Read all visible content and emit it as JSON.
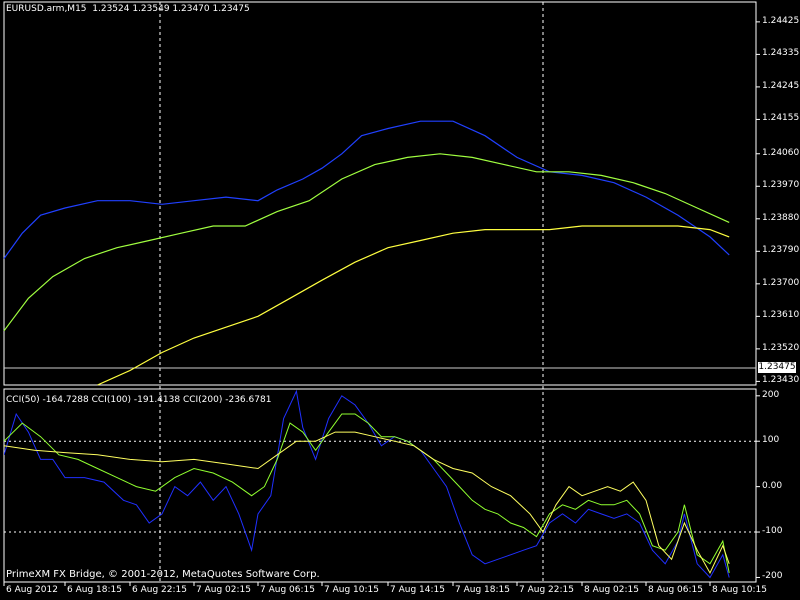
{
  "header": {
    "symbol": "EURUSD.arm,M15",
    "ohlc": "1.23524 1.23549 1.23470 1.23475"
  },
  "cci_header": {
    "text": "CCI(50) -164.7288  CCI(100) -191.4138  CCI(200) -236.6781"
  },
  "footer": {
    "text": "PrimeXM FX Bridge, © 2001-2012, MetaQuotes Software Corp."
  },
  "current_price": "1.23475",
  "colors": {
    "background": "#000000",
    "axis": "#ffffff",
    "upper": "#2040ff",
    "middle": "#a0ff40",
    "lower": "#ffff40",
    "cci_blue": "#2030ff",
    "cci_green": "#90ff30",
    "cci_yellow": "#ffff60"
  },
  "chart_data": [
    {
      "type": "line",
      "name": "price",
      "y_ticks": [
        "1.24425",
        "1.24335",
        "1.24245",
        "1.24155",
        "1.24060",
        "1.23970",
        "1.23880",
        "1.23790",
        "1.23700",
        "1.23610",
        "1.23520",
        "1.23430"
      ],
      "y_tick_values": [
        1.24425,
        1.24335,
        1.24245,
        1.24155,
        1.2406,
        1.2397,
        1.2388,
        1.2379,
        1.237,
        1.2361,
        1.2352,
        1.2343
      ],
      "ylim": [
        1.2342,
        1.2448
      ],
      "x_ticks": [
        "6 Aug 2012",
        "6 Aug 18:15",
        "6 Aug 22:15",
        "7 Aug 02:15",
        "7 Aug 06:15",
        "7 Aug 10:15",
        "7 Aug 14:15",
        "7 Aug 18:15",
        "7 Aug 22:15",
        "8 Aug 02:15",
        "8 Aug 06:15",
        "8 Aug 10:15"
      ],
      "x_tick_index": [
        0,
        1,
        2,
        3,
        4,
        5,
        6,
        7,
        8,
        9,
        10,
        11
      ],
      "xlim": [
        0,
        11.6
      ],
      "series": [
        {
          "values": [
            [
              0,
              1.2377
            ],
            [
              0.3,
              1.2384
            ],
            [
              0.6,
              1.2389
            ],
            [
              1.0,
              1.2391
            ],
            [
              1.5,
              1.2393
            ],
            [
              2.0,
              1.2393
            ],
            [
              2.5,
              1.2392
            ],
            [
              3.0,
              1.2393
            ],
            [
              3.5,
              1.2394
            ],
            [
              4.0,
              1.2393
            ],
            [
              4.3,
              1.2396
            ],
            [
              4.7,
              1.2399
            ],
            [
              5.0,
              1.2402
            ],
            [
              5.3,
              1.2406
            ],
            [
              5.6,
              1.2411
            ],
            [
              6.0,
              1.2413
            ],
            [
              6.5,
              1.2415
            ],
            [
              7.0,
              1.2415
            ],
            [
              7.5,
              1.2411
            ],
            [
              8.0,
              1.2405
            ],
            [
              8.5,
              1.2401
            ],
            [
              9.0,
              1.24
            ],
            [
              9.5,
              1.2398
            ],
            [
              10.0,
              1.2394
            ],
            [
              10.5,
              1.2389
            ],
            [
              11.0,
              1.2383
            ],
            [
              11.3,
              1.2378
            ]
          ]
        },
        {
          "values": [
            [
              0,
              1.2357
            ],
            [
              0.4,
              1.2366
            ],
            [
              0.8,
              1.2372
            ],
            [
              1.3,
              1.2377
            ],
            [
              1.8,
              1.238
            ],
            [
              2.3,
              1.2382
            ],
            [
              2.8,
              1.2384
            ],
            [
              3.3,
              1.2386
            ],
            [
              3.8,
              1.2386
            ],
            [
              4.3,
              1.239
            ],
            [
              4.8,
              1.2393
            ],
            [
              5.3,
              1.2399
            ],
            [
              5.8,
              1.2403
            ],
            [
              6.3,
              1.2405
            ],
            [
              6.8,
              1.2406
            ],
            [
              7.3,
              1.2405
            ],
            [
              7.8,
              1.2403
            ],
            [
              8.3,
              1.2401
            ],
            [
              8.8,
              1.2401
            ],
            [
              9.3,
              1.24
            ],
            [
              9.8,
              1.2398
            ],
            [
              10.3,
              1.2395
            ],
            [
              10.8,
              1.2391
            ],
            [
              11.3,
              1.2387
            ]
          ]
        },
        {
          "values": [
            [
              1.5,
              1.2342
            ],
            [
              2.0,
              1.2346
            ],
            [
              2.5,
              1.2351
            ],
            [
              3.0,
              1.2355
            ],
            [
              3.5,
              1.2358
            ],
            [
              4.0,
              1.2361
            ],
            [
              4.5,
              1.2366
            ],
            [
              5.0,
              1.2371
            ],
            [
              5.5,
              1.2376
            ],
            [
              6.0,
              1.238
            ],
            [
              6.5,
              1.2382
            ],
            [
              7.0,
              1.2384
            ],
            [
              7.5,
              1.2385
            ],
            [
              8.0,
              1.2385
            ],
            [
              8.5,
              1.2385
            ],
            [
              9.0,
              1.2386
            ],
            [
              9.5,
              1.2386
            ],
            [
              10.0,
              1.2386
            ],
            [
              10.5,
              1.2386
            ],
            [
              11.0,
              1.2385
            ],
            [
              11.3,
              1.2383
            ]
          ]
        }
      ]
    },
    {
      "type": "line",
      "name": "cci",
      "y_ticks": [
        "200",
        "100",
        "0.00",
        "-100",
        "-200"
      ],
      "y_tick_values": [
        200,
        100,
        0,
        -100,
        -200
      ],
      "ylim": [
        -210,
        215
      ],
      "xlim": [
        0,
        11.6
      ],
      "series": [
        {
          "values": [
            [
              0,
              70
            ],
            [
              0.2,
              160
            ],
            [
              0.4,
              120
            ],
            [
              0.6,
              60
            ],
            [
              0.8,
              60
            ],
            [
              1.0,
              20
            ],
            [
              1.3,
              20
            ],
            [
              1.6,
              10
            ],
            [
              1.9,
              -30
            ],
            [
              2.1,
              -40
            ],
            [
              2.3,
              -80
            ],
            [
              2.5,
              -60
            ],
            [
              2.7,
              0
            ],
            [
              2.9,
              -20
            ],
            [
              3.1,
              10
            ],
            [
              3.3,
              -30
            ],
            [
              3.5,
              0
            ],
            [
              3.7,
              -60
            ],
            [
              3.9,
              -140
            ],
            [
              4.0,
              -60
            ],
            [
              4.2,
              -20
            ],
            [
              4.4,
              150
            ],
            [
              4.6,
              210
            ],
            [
              4.7,
              130
            ],
            [
              4.9,
              60
            ],
            [
              5.1,
              150
            ],
            [
              5.3,
              200
            ],
            [
              5.5,
              180
            ],
            [
              5.7,
              140
            ],
            [
              5.9,
              90
            ],
            [
              6.1,
              110
            ],
            [
              6.3,
              100
            ],
            [
              6.5,
              80
            ],
            [
              6.7,
              40
            ],
            [
              6.9,
              0
            ],
            [
              7.1,
              -80
            ],
            [
              7.3,
              -150
            ],
            [
              7.5,
              -170
            ],
            [
              7.7,
              -160
            ],
            [
              7.9,
              -150
            ],
            [
              8.1,
              -140
            ],
            [
              8.3,
              -130
            ],
            [
              8.5,
              -80
            ],
            [
              8.7,
              -60
            ],
            [
              8.9,
              -80
            ],
            [
              9.1,
              -50
            ],
            [
              9.3,
              -60
            ],
            [
              9.5,
              -70
            ],
            [
              9.7,
              -60
            ],
            [
              9.9,
              -80
            ],
            [
              10.1,
              -140
            ],
            [
              10.3,
              -170
            ],
            [
              10.5,
              -120
            ],
            [
              10.6,
              -60
            ],
            [
              10.8,
              -170
            ],
            [
              11.0,
              -200
            ],
            [
              11.2,
              -150
            ],
            [
              11.3,
              -200
            ]
          ]
        },
        {
          "values": [
            [
              0,
              100
            ],
            [
              0.3,
              140
            ],
            [
              0.6,
              110
            ],
            [
              0.9,
              70
            ],
            [
              1.2,
              60
            ],
            [
              1.5,
              40
            ],
            [
              1.8,
              20
            ],
            [
              2.1,
              0
            ],
            [
              2.4,
              -10
            ],
            [
              2.7,
              20
            ],
            [
              3.0,
              40
            ],
            [
              3.3,
              30
            ],
            [
              3.6,
              10
            ],
            [
              3.9,
              -20
            ],
            [
              4.1,
              0
            ],
            [
              4.3,
              60
            ],
            [
              4.5,
              140
            ],
            [
              4.7,
              120
            ],
            [
              4.9,
              80
            ],
            [
              5.1,
              120
            ],
            [
              5.3,
              160
            ],
            [
              5.5,
              160
            ],
            [
              5.7,
              140
            ],
            [
              5.9,
              110
            ],
            [
              6.1,
              110
            ],
            [
              6.3,
              100
            ],
            [
              6.5,
              80
            ],
            [
              6.7,
              60
            ],
            [
              6.9,
              30
            ],
            [
              7.1,
              0
            ],
            [
              7.3,
              -30
            ],
            [
              7.5,
              -50
            ],
            [
              7.7,
              -60
            ],
            [
              7.9,
              -80
            ],
            [
              8.1,
              -90
            ],
            [
              8.3,
              -110
            ],
            [
              8.5,
              -60
            ],
            [
              8.7,
              -40
            ],
            [
              8.9,
              -50
            ],
            [
              9.1,
              -30
            ],
            [
              9.3,
              -40
            ],
            [
              9.5,
              -40
            ],
            [
              9.7,
              -30
            ],
            [
              9.9,
              -60
            ],
            [
              10.1,
              -130
            ],
            [
              10.3,
              -140
            ],
            [
              10.5,
              -100
            ],
            [
              10.6,
              -40
            ],
            [
              10.8,
              -150
            ],
            [
              11.0,
              -170
            ],
            [
              11.2,
              -120
            ],
            [
              11.3,
              -190
            ]
          ]
        },
        {
          "values": [
            [
              0,
              90
            ],
            [
              0.5,
              80
            ],
            [
              1.0,
              75
            ],
            [
              1.5,
              70
            ],
            [
              2.0,
              60
            ],
            [
              2.5,
              55
            ],
            [
              3.0,
              60
            ],
            [
              3.5,
              50
            ],
            [
              4.0,
              40
            ],
            [
              4.3,
              70
            ],
            [
              4.6,
              100
            ],
            [
              4.9,
              100
            ],
            [
              5.2,
              120
            ],
            [
              5.5,
              120
            ],
            [
              5.8,
              110
            ],
            [
              6.1,
              100
            ],
            [
              6.4,
              90
            ],
            [
              6.7,
              60
            ],
            [
              7.0,
              40
            ],
            [
              7.3,
              30
            ],
            [
              7.6,
              0
            ],
            [
              7.9,
              -20
            ],
            [
              8.2,
              -60
            ],
            [
              8.4,
              -100
            ],
            [
              8.6,
              -40
            ],
            [
              8.8,
              0
            ],
            [
              9.0,
              -20
            ],
            [
              9.2,
              -10
            ],
            [
              9.4,
              0
            ],
            [
              9.6,
              -10
            ],
            [
              9.8,
              10
            ],
            [
              10.0,
              -30
            ],
            [
              10.2,
              -130
            ],
            [
              10.4,
              -160
            ],
            [
              10.6,
              -80
            ],
            [
              10.8,
              -140
            ],
            [
              11.0,
              -190
            ],
            [
              11.2,
              -130
            ],
            [
              11.3,
              -170
            ]
          ]
        }
      ]
    }
  ]
}
